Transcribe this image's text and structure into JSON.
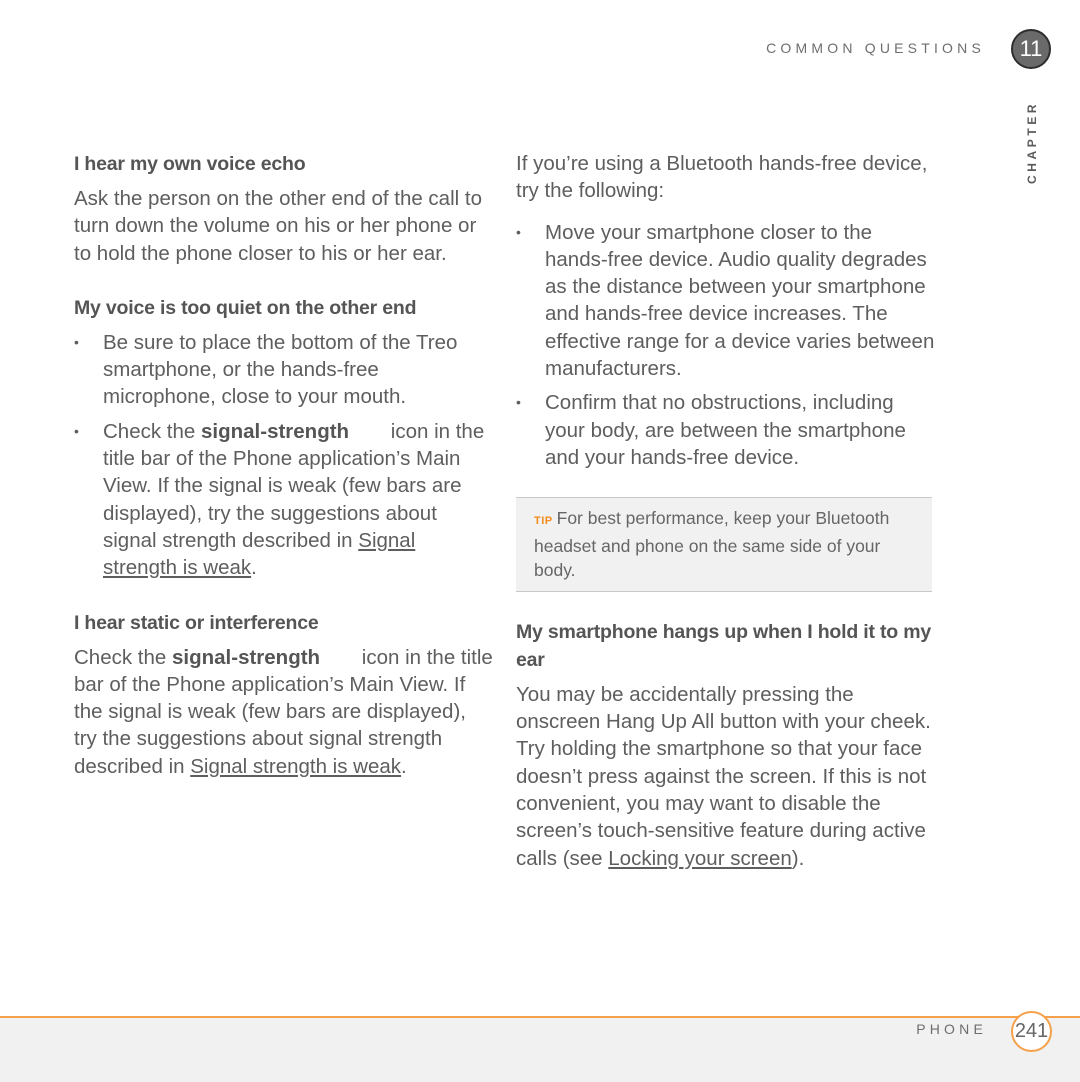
{
  "header": {
    "section_label": "COMMON QUESTIONS",
    "chapter_number": "11",
    "chapter_label": "CHAPTER"
  },
  "left_column": {
    "section1": {
      "title": "I hear my own voice echo",
      "body": "Ask the person on the other end of the call to turn down the volume on his or her phone or to hold the phone closer to his or her ear."
    },
    "section2": {
      "title": "My voice is too quiet on the other end",
      "bullet1": "Be sure to place the bottom of the Treo smartphone, or the hands-free microphone, close to your mouth.",
      "bullet2": {
        "pre": "Check the ",
        "bold": "signal-strength",
        "mid": " icon in the title bar of the Phone application’s Main View. If the signal is weak (few bars are displayed), try the suggestions about signal strength described in ",
        "link": "Signal strength is weak",
        "post": "."
      }
    },
    "section3": {
      "title": "I hear static or interference",
      "pre": "Check the ",
      "bold": "signal-strength",
      "mid": " icon in the title bar of the Phone application’s Main View. If the signal is weak (few bars are displayed), try the suggestions about signal strength described in ",
      "link": "Signal strength is weak",
      "post": "."
    }
  },
  "right_column": {
    "intro": "If you’re using a Bluetooth hands-free device, try the following:",
    "bullets": [
      "Move your smartphone closer to the hands-free device. Audio quality degrades as the distance between your smartphone and hands-free device increases. The effective range for a device varies between manufacturers.",
      "Confirm that no obstructions, including your body, are between the smartphone and your hands-free device."
    ],
    "tip": {
      "label": "TIP",
      "text": "For best performance, keep your Bluetooth headset and phone on the same side of your body."
    },
    "section4": {
      "title": "My smartphone hangs up when I hold it to my ear",
      "pre": "You may be accidentally pressing the onscreen Hang Up All button with your cheek. Try holding the smartphone so that your face doesn’t press against the screen. If this is not convenient, you may want to disable the screen’s touch-sensitive feature during active calls (see ",
      "link": "Locking your screen",
      "post": ")."
    }
  },
  "footer": {
    "label": "PHONE",
    "page_number": "241"
  },
  "colors": {
    "accent": "#f5a04a",
    "tip_label": "#f28c1a",
    "text": "#5e5e5e",
    "footer_band": "#f1f1f1",
    "chapter_circle": "#6a6a6a"
  }
}
